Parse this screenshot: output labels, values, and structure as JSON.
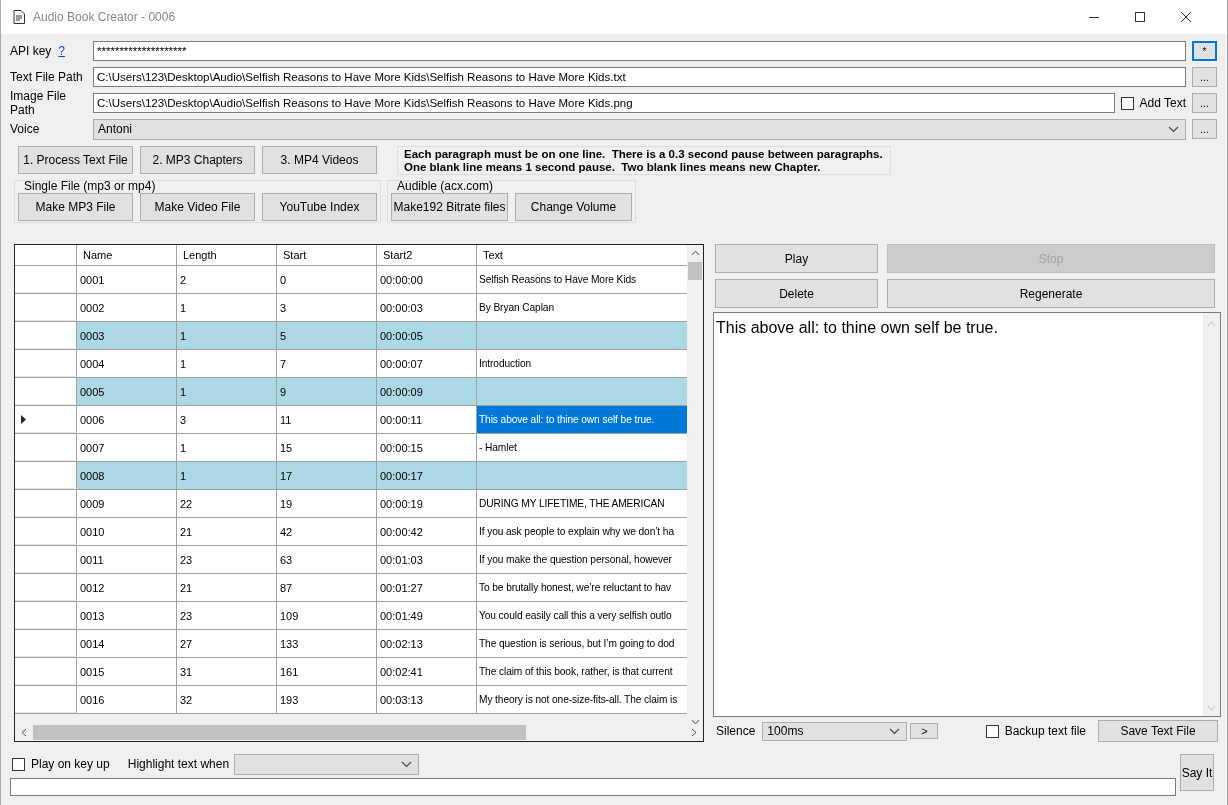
{
  "window": {
    "title": "Audio Book Creator - 0006"
  },
  "api_key": {
    "label": "API key",
    "help_link": "?",
    "value": "********************",
    "button": "*",
    "button_focused": true
  },
  "text_file_path": {
    "label": "Text File Path",
    "value": "C:\\Users\\123\\Desktop\\Audio\\Selfish Reasons to Have More Kids\\Selfish Reasons to Have More Kids.txt",
    "button": "..."
  },
  "image_file_path": {
    "label": "Image File Path",
    "value": "C:\\Users\\123\\Desktop\\Audio\\Selfish Reasons to Have More Kids\\Selfish Reasons to Have More Kids.png",
    "checkbox": {
      "label": "Add Text",
      "checked": false
    },
    "button": "..."
  },
  "voice": {
    "label": "Voice",
    "value": "Antoni",
    "button": "..."
  },
  "main_buttons": [
    "1. Process Text File",
    "2. MP3 Chapters",
    "3. MP4 Videos"
  ],
  "info_lines": [
    "Each paragraph must be on one line.  There is a 0.3 second pause between paragraphs.",
    "One blank line means 1 second pause.  Two blank lines means new Chapter."
  ],
  "groups": [
    {
      "title": "Single File (mp3 or mp4)",
      "buttons": [
        "Make MP3 File",
        "Make Video File",
        "YouTube Index"
      ]
    },
    {
      "title": "Audible (acx.com)",
      "buttons": [
        "Make192 Bitrate files",
        "Change Volume"
      ]
    }
  ],
  "table": {
    "columns": [
      "Name",
      "Length",
      "Start",
      "Start2",
      "Text"
    ],
    "rows": [
      {
        "cells": [
          "0001",
          "2",
          "0",
          "00:00:00",
          "Selfish Reasons to Have More Kids"
        ],
        "highlighted": false,
        "current": false
      },
      {
        "cells": [
          "0002",
          "1",
          "3",
          "00:00:03",
          "By Bryan Caplan"
        ],
        "highlighted": false,
        "current": false
      },
      {
        "cells": [
          "0003",
          "1",
          "5",
          "00:00:05",
          ""
        ],
        "highlighted": true,
        "current": false
      },
      {
        "cells": [
          "0004",
          "1",
          "7",
          "00:00:07",
          "Introduction"
        ],
        "highlighted": false,
        "current": false
      },
      {
        "cells": [
          "0005",
          "1",
          "9",
          "00:00:09",
          ""
        ],
        "highlighted": true,
        "current": false
      },
      {
        "cells": [
          "0006",
          "3",
          "11",
          "00:00:11",
          "This above all: to thine own self be true."
        ],
        "highlighted": false,
        "current": true
      },
      {
        "cells": [
          "0007",
          "1",
          "15",
          "00:00:15",
          "- Hamlet"
        ],
        "highlighted": false,
        "current": false
      },
      {
        "cells": [
          "0008",
          "1",
          "17",
          "00:00:17",
          ""
        ],
        "highlighted": true,
        "current": false
      },
      {
        "cells": [
          "0009",
          "22",
          "19",
          "00:00:19",
          "DURING MY LIFETIME, THE AMERICAN"
        ],
        "highlighted": false,
        "current": false
      },
      {
        "cells": [
          "0010",
          "21",
          "42",
          "00:00:42",
          "If you ask people to explain why we don’t ha"
        ],
        "highlighted": false,
        "current": false
      },
      {
        "cells": [
          "0011",
          "23",
          "63",
          "00:01:03",
          "If you make the question personal, however"
        ],
        "highlighted": false,
        "current": false
      },
      {
        "cells": [
          "0012",
          "21",
          "87",
          "00:01:27",
          "To be brutally honest, we’re reluctant to hav"
        ],
        "highlighted": false,
        "current": false
      },
      {
        "cells": [
          "0013",
          "23",
          "109",
          "00:01:49",
          "You could easily call this a very selfish outlo"
        ],
        "highlighted": false,
        "current": false
      },
      {
        "cells": [
          "0014",
          "27",
          "133",
          "00:02:13",
          "The question is serious, but I’m going to dod"
        ],
        "highlighted": false,
        "current": false
      },
      {
        "cells": [
          "0015",
          "31",
          "161",
          "00:02:41",
          "The claim of this book, rather, is that current"
        ],
        "highlighted": false,
        "current": false
      },
      {
        "cells": [
          "0016",
          "32",
          "193",
          "00:03:13",
          "My theory is not one-size-fits-all. The claim is"
        ],
        "highlighted": false,
        "current": false
      }
    ]
  },
  "actions": [
    {
      "label": "Play",
      "disabled": false
    },
    {
      "label": "Stop",
      "disabled": true
    },
    {
      "label": "Delete",
      "disabled": false
    },
    {
      "label": "Regenerate",
      "disabled": false
    }
  ],
  "editor": {
    "value": "This above all: to thine own self be true."
  },
  "silence": {
    "label": "Silence",
    "value": "100ms",
    "button": ">"
  },
  "backup": {
    "label": "Backup text file",
    "checked": false
  },
  "save_button": "Save Text File",
  "play_on_key_up": {
    "label": "Play on key up",
    "checked": false
  },
  "highlight": {
    "label": "Highlight text when"
  },
  "say_it": "Say It"
}
